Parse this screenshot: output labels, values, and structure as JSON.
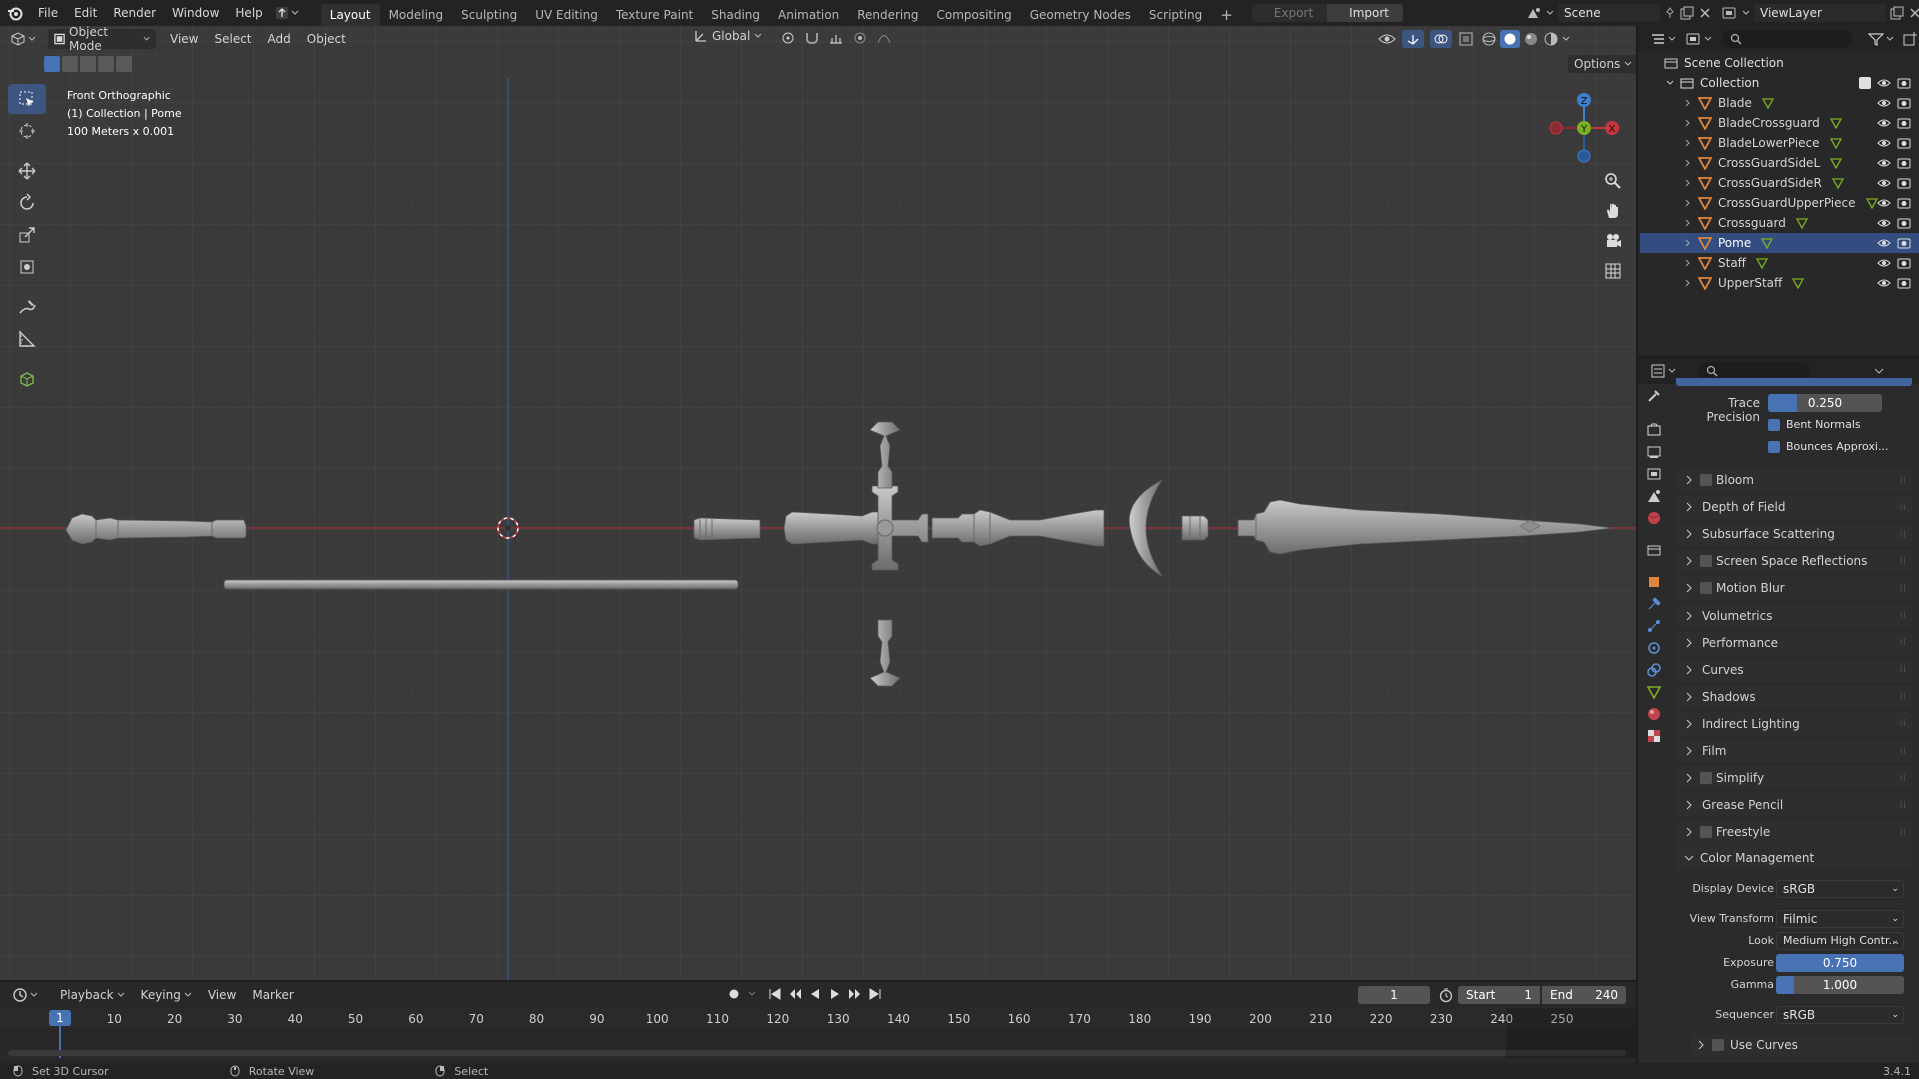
{
  "topbar": {
    "menus": [
      "File",
      "Edit",
      "Render",
      "Window",
      "Help"
    ],
    "workspaces": [
      "Layout",
      "Modeling",
      "Sculpting",
      "UV Editing",
      "Texture Paint",
      "Shading",
      "Animation",
      "Rendering",
      "Compositing",
      "Geometry Nodes",
      "Scripting"
    ],
    "active_workspace": "Layout",
    "export_label": "Export",
    "import_label": "Import",
    "scene": "Scene",
    "view_layer": "ViewLayer"
  },
  "viewport_header": {
    "mode": "Object Mode",
    "menus": [
      "View",
      "Select",
      "Add",
      "Object"
    ],
    "orientation": "Global",
    "options_label": "Options"
  },
  "viewport_overlay": {
    "view_name": "Front Orthographic",
    "collection_info": "(1) Collection | Pome",
    "scale_info": "100 Meters x 0.001"
  },
  "gizmo": {
    "z": "Z",
    "x": "X",
    "y": "Y"
  },
  "outliner": {
    "root": "Scene Collection",
    "collection": "Collection",
    "objects": [
      "Blade",
      "BladeCrossguard",
      "BladeLowerPiece",
      "CrossGuardSideL",
      "CrossGuardSideR",
      "CrossGuardUpperPiece",
      "Crossguard",
      "Pome",
      "Staff",
      "UpperStaff"
    ],
    "active_object": "Pome"
  },
  "properties": {
    "trace_precision_label": "Trace Precision",
    "trace_precision_value": "0.250",
    "trace_precision_fill": 0.25,
    "bent_normals": "Bent Normals",
    "bounces_approx": "Bounces Approxi...",
    "panels": [
      {
        "label": "Bloom",
        "checkbox": true
      },
      {
        "label": "Depth of Field",
        "checkbox": false
      },
      {
        "label": "Subsurface Scattering",
        "checkbox": false
      },
      {
        "label": "Screen Space Reflections",
        "checkbox": true
      },
      {
        "label": "Motion Blur",
        "checkbox": true
      },
      {
        "label": "Volumetrics",
        "checkbox": false
      },
      {
        "label": "Performance",
        "checkbox": false
      },
      {
        "label": "Curves",
        "checkbox": false
      },
      {
        "label": "Shadows",
        "checkbox": false
      },
      {
        "label": "Indirect Lighting",
        "checkbox": false
      },
      {
        "label": "Film",
        "checkbox": false
      },
      {
        "label": "Simplify",
        "checkbox": true
      },
      {
        "label": "Grease Pencil",
        "checkbox": false
      },
      {
        "label": "Freestyle",
        "checkbox": true
      }
    ],
    "color_management": {
      "title": "Color Management",
      "display_device_label": "Display Device",
      "display_device": "sRGB",
      "view_transform_label": "View Transform",
      "view_transform": "Filmic",
      "look_label": "Look",
      "look": "Medium High Contr...",
      "exposure_label": "Exposure",
      "exposure": "0.750",
      "gamma_label": "Gamma",
      "gamma": "1.000",
      "sequencer_label": "Sequencer",
      "sequencer": "sRGB",
      "use_curves": "Use Curves"
    }
  },
  "timeline": {
    "menus": [
      "Playback",
      "Keying",
      "View",
      "Marker"
    ],
    "current_frame": "1",
    "start_label": "Start",
    "start": "1",
    "end_label": "End",
    "end": "240",
    "ruler": [
      "1",
      "10",
      "20",
      "30",
      "40",
      "50",
      "60",
      "70",
      "80",
      "90",
      "100",
      "110",
      "120",
      "130",
      "140",
      "150",
      "160",
      "170",
      "180",
      "190",
      "200",
      "210",
      "220",
      "230",
      "240",
      "250"
    ]
  },
  "statusbar": {
    "hint1": "Set 3D Cursor",
    "hint2": "Rotate View",
    "hint3": "Select",
    "version": "3.4.1"
  },
  "colors": {
    "accent": "#4772b3",
    "x_axis": "#c8363d",
    "y_axis": "#7bb023",
    "z_axis": "#3f7fd0",
    "object_icon": "#e0863c"
  }
}
